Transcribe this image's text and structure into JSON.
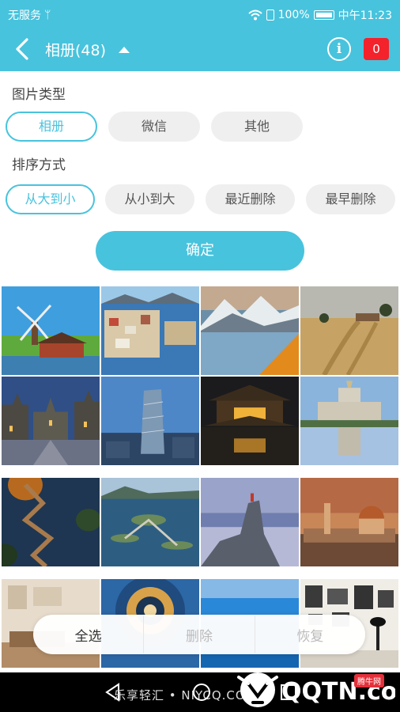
{
  "statusbar": {
    "carrier": "无服务",
    "battery": "100%",
    "time": "中午11:23"
  },
  "appbar": {
    "title": "相册(48)",
    "badge_count": "0"
  },
  "filters": {
    "type_label": "图片类型",
    "type_options": [
      "相册",
      "微信",
      "其他"
    ],
    "type_selected": "相册",
    "sort_label": "排序方式",
    "sort_options": [
      "从大到小",
      "从小到大",
      "最近删除",
      "最早删除"
    ],
    "sort_selected": "从大到小",
    "confirm_label": "确定"
  },
  "photos": [
    "windmill-photo",
    "coastal-town-photo",
    "mountain-lake-photo",
    "wheat-field-photo",
    "old-town-photo",
    "twisted-tower-photo",
    "temple-night-photo",
    "palace-reflection-photo",
    "zigzag-road-photo",
    "island-bridge-photo",
    "rock-climber-photo",
    "cathedral-city-photo",
    "living-room-photo",
    "spiral-vault-photo",
    "coastline-photo",
    "gallery-wall-photo"
  ],
  "actions": {
    "select_all": "全选",
    "delete": "删除",
    "restore": "恢复"
  },
  "watermark": {
    "text": "乐享轻汇 • NIYCQ.COM",
    "logo": "QQTN.com",
    "tag": "腾牛网"
  },
  "colors": {
    "accent": "#48c3dd",
    "badge": "#f4222b",
    "chip_bg": "#efefef"
  }
}
